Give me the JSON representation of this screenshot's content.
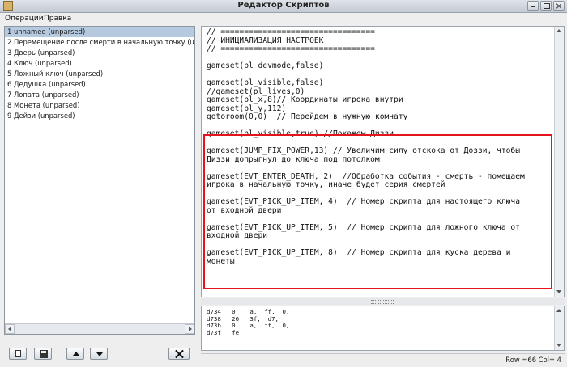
{
  "window": {
    "title": "Редактор Скриптов"
  },
  "menu": {
    "operations": "Операции",
    "edit": "Правка"
  },
  "scripts": [
    "1 unnamed  (unparsed)",
    "2 Перемещение после смерти в начальную точку  (unparsed)",
    "3 Дверь  (unparsed)",
    "4 Ключ  (unparsed)",
    "5 Ложный ключ  (unparsed)",
    "6 Дедушка  (unparsed)",
    "7 Лопата  (unparsed)",
    "8 Монета  (unparsed)",
    "9 Дейзи  (unparsed)"
  ],
  "selected_index": 0,
  "code_lines": [
    "// =================================",
    "// ИНИЦИАЛИЗАЦИЯ НАСТРОЕК",
    "// =================================",
    "",
    "gameset(pl_devmode,false)",
    "",
    "gameset(pl_visible,false)",
    "//gameset(pl_lives,0)",
    "gameset(pl_x,8)// Координаты игрока внутри",
    "gameset(pl_y,112)",
    "gotoroom(0,0)  // Перейдем в нужную комнату",
    "",
    "gameset(pl_visible,true) //Покажем Диззи",
    "",
    "gameset(JUMP_FIX_POWER,13) // Увеличим силу отскока от Доззи, чтобы",
    "Диззи допрыгнул до ключа под потолком",
    "",
    "gameset(EVT_ENTER_DEATH, 2)  //Обработка события - смерть - помещаем",
    "игрока в начальную точку, иначе будет серия смертей",
    "",
    "gameset(EVT_PICK_UP_ITEM, 4)  // Номер скрипта для настоящего ключа",
    "от входной двери",
    "",
    "gameset(EVT_PICK_UP_ITEM, 5)  // Номер скрипта для ложного ключа от",
    "входной двери",
    "",
    "gameset(EVT_PICK_UP_ITEM, 8)  // Номер скрипта для куска дерева и",
    "монеты"
  ],
  "bytecode_lines": [
    "d734   0    a,  ff,  0,",
    "d738   26   3f,  d7,",
    "d73b   0    a,  ff,  0,",
    "d73f   fe"
  ],
  "status": {
    "text": "Row =66 Col= 4"
  },
  "colors": {
    "highlight": "#e3141c",
    "selection": "#b6cadf"
  }
}
